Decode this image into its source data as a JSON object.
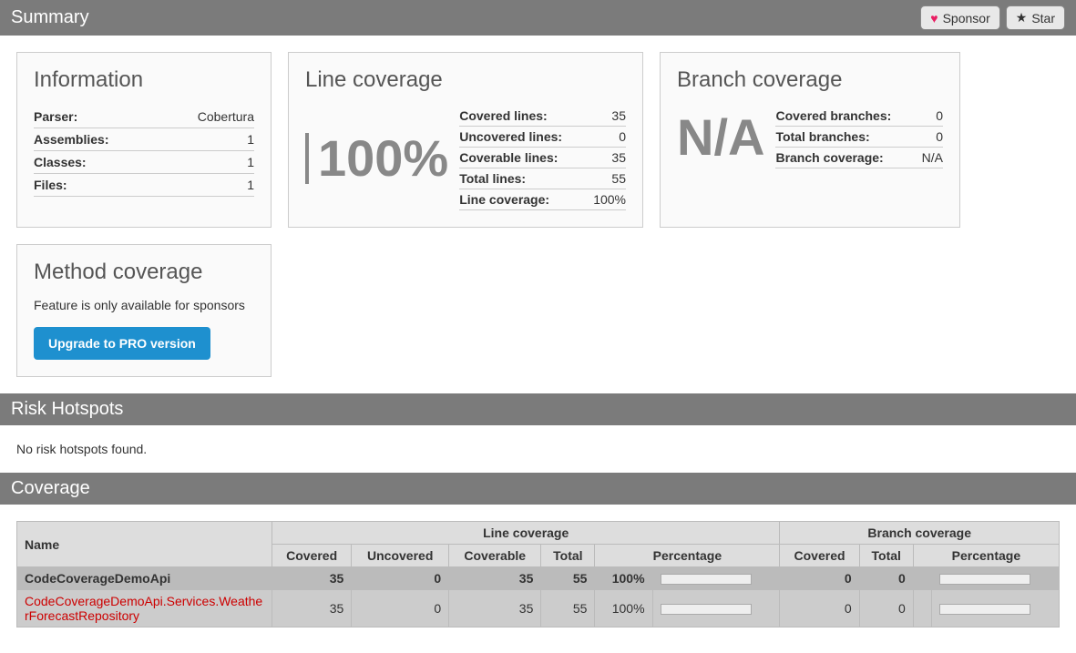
{
  "header": {
    "title": "Summary",
    "sponsor_label": "Sponsor",
    "star_label": "Star"
  },
  "information": {
    "title": "Information",
    "rows": [
      {
        "label": "Parser:",
        "value": "Cobertura"
      },
      {
        "label": "Assemblies:",
        "value": "1"
      },
      {
        "label": "Classes:",
        "value": "1"
      },
      {
        "label": "Files:",
        "value": "1"
      }
    ]
  },
  "line_coverage": {
    "title": "Line coverage",
    "big": "100%",
    "rows": [
      {
        "label": "Covered lines:",
        "value": "35"
      },
      {
        "label": "Uncovered lines:",
        "value": "0"
      },
      {
        "label": "Coverable lines:",
        "value": "35"
      },
      {
        "label": "Total lines:",
        "value": "55"
      },
      {
        "label": "Line coverage:",
        "value": "100%"
      }
    ]
  },
  "branch_coverage": {
    "title": "Branch coverage",
    "big": "N/A",
    "rows": [
      {
        "label": "Covered branches:",
        "value": "0"
      },
      {
        "label": "Total branches:",
        "value": "0"
      },
      {
        "label": "Branch coverage:",
        "value": "N/A"
      }
    ]
  },
  "method_coverage": {
    "title": "Method coverage",
    "sponsor_text": "Feature is only available for sponsors",
    "upgrade_label": "Upgrade to PRO version"
  },
  "risk_hotspots": {
    "title": "Risk Hotspots",
    "message": "No risk hotspots found."
  },
  "coverage_section": {
    "title": "Coverage",
    "group_headers": {
      "line": "Line coverage",
      "branch": "Branch coverage"
    },
    "columns": {
      "name": "Name",
      "covered": "Covered",
      "uncovered": "Uncovered",
      "coverable": "Coverable",
      "total": "Total",
      "percentage": "Percentage",
      "b_covered": "Covered",
      "b_total": "Total",
      "b_percentage": "Percentage"
    },
    "rows": [
      {
        "type": "assembly",
        "name": "CodeCoverageDemoApi",
        "covered": "35",
        "uncovered": "0",
        "coverable": "35",
        "total": "55",
        "pct": "100%",
        "b_covered": "0",
        "b_total": "0",
        "b_pct": ""
      },
      {
        "type": "class",
        "name": "CodeCoverageDemoApi.Services.WeatherForecastRepository",
        "covered": "35",
        "uncovered": "0",
        "coverable": "35",
        "total": "55",
        "pct": "100%",
        "b_covered": "0",
        "b_total": "0",
        "b_pct": ""
      }
    ]
  }
}
